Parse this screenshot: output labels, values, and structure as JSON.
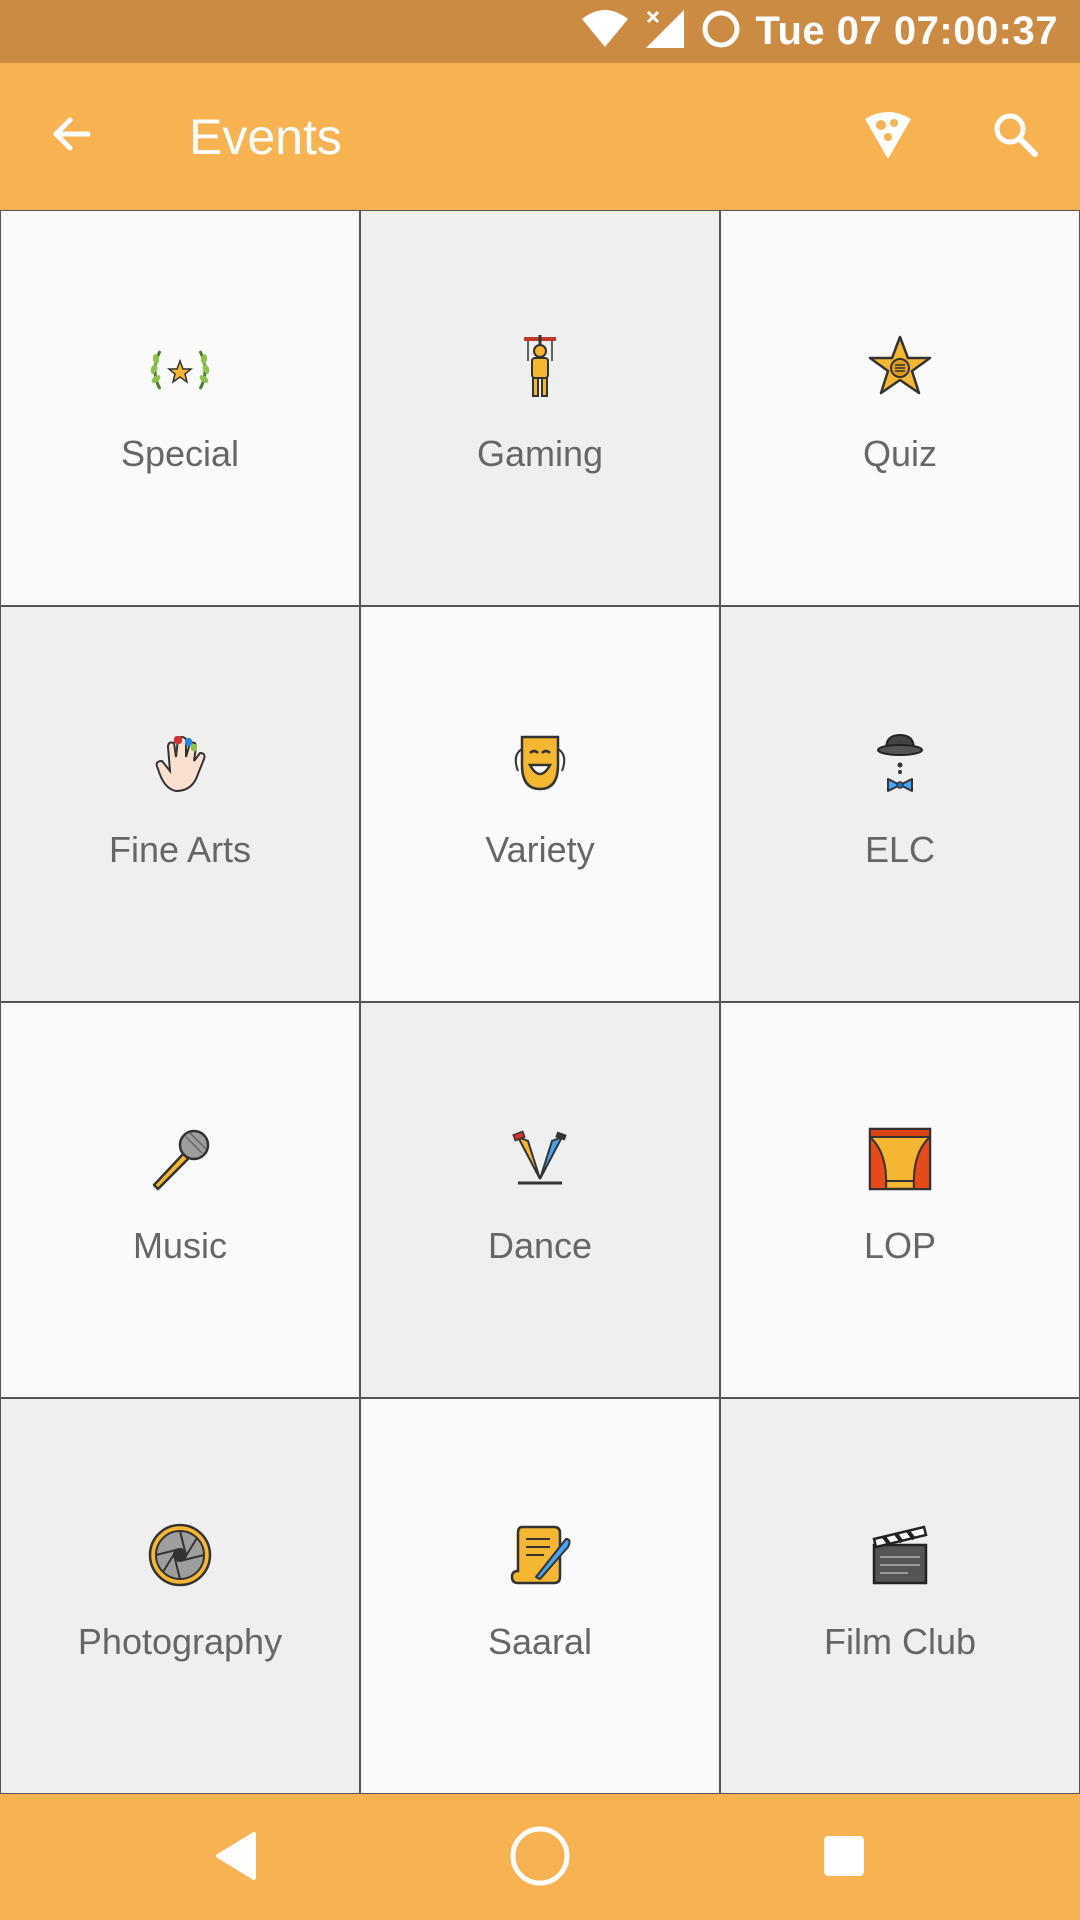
{
  "status_bar": {
    "time": "Tue 07 07:00:37",
    "icons": [
      "wifi-icon",
      "signal-off-icon",
      "circle-indicator-icon"
    ]
  },
  "app_bar": {
    "title": "Events",
    "left_icon": "back-arrow-icon",
    "right_icons": [
      "pizza-icon",
      "search-icon"
    ]
  },
  "categories": [
    {
      "label": "Special",
      "icon": "laurel-star-icon"
    },
    {
      "label": "Gaming",
      "icon": "puppet-icon"
    },
    {
      "label": "Quiz",
      "icon": "star-badge-icon"
    },
    {
      "label": "Fine Arts",
      "icon": "painted-fingers-icon"
    },
    {
      "label": "Variety",
      "icon": "theatre-mask-icon"
    },
    {
      "label": "ELC",
      "icon": "bowler-hat-bowtie-icon"
    },
    {
      "label": "Music",
      "icon": "microphone-icon"
    },
    {
      "label": "Dance",
      "icon": "spotlights-icon"
    },
    {
      "label": "LOP",
      "icon": "stage-curtain-icon"
    },
    {
      "label": "Photography",
      "icon": "camera-aperture-icon"
    },
    {
      "label": "Saaral",
      "icon": "scroll-quill-icon"
    },
    {
      "label": "Film Club",
      "icon": "clapperboard-icon"
    }
  ],
  "nav_bar": {
    "buttons": [
      "back-triangle-icon",
      "home-circle-icon",
      "recents-square-icon"
    ]
  },
  "colors": {
    "status_bar": "#cc8b42",
    "app_bar": "#f7b352",
    "tile_light": "#fafafa",
    "tile_dark": "#efefef",
    "label_text": "#666666"
  }
}
